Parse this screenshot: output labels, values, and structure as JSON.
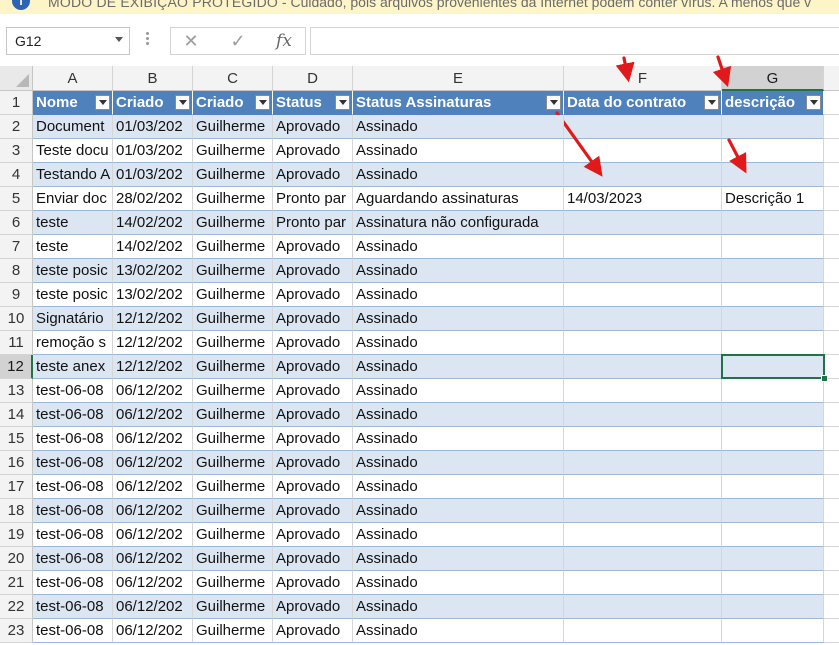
{
  "banner": {
    "title": "MODO DE EXIBIÇÃO PROTEGIDO",
    "message": "Cuidado, pois arquivos provenientes da Internet podem conter vírus. A menos que v"
  },
  "formula_bar": {
    "name_box": "G12",
    "cancel_icon": "✕",
    "enter_icon": "✓",
    "fx_label": "fx",
    "value": ""
  },
  "columns": [
    "A",
    "B",
    "C",
    "D",
    "E",
    "F",
    "G"
  ],
  "selected_cell": "G12",
  "headers": [
    "Nome",
    "Criado",
    "Criado",
    "Status",
    "Status Assinaturas",
    "Data do contrato",
    "descrição"
  ],
  "rows": [
    [
      "2",
      "Document",
      "01/03/202",
      "Guilherme",
      "Aprovado",
      "Assinado",
      "",
      ""
    ],
    [
      "3",
      "Teste docu",
      "01/03/202",
      "Guilherme",
      "Aprovado",
      "Assinado",
      "",
      ""
    ],
    [
      "4",
      "Testando A",
      "01/03/202",
      "Guilherme",
      "Aprovado",
      "Assinado",
      "",
      ""
    ],
    [
      "5",
      "Enviar doc",
      "28/02/202",
      "Guilherme",
      "Pronto par",
      "Aguardando assinaturas",
      "14/03/2023",
      "Descrição 1"
    ],
    [
      "6",
      "teste",
      "14/02/202",
      "Guilherme",
      "Pronto par",
      "Assinatura não configurada",
      "",
      ""
    ],
    [
      "7",
      "teste",
      "14/02/202",
      "Guilherme",
      "Aprovado",
      "Assinado",
      "",
      ""
    ],
    [
      "8",
      "teste posic",
      "13/02/202",
      "Guilherme",
      "Aprovado",
      "Assinado",
      "",
      ""
    ],
    [
      "9",
      "teste posic",
      "13/02/202",
      "Guilherme",
      "Aprovado",
      "Assinado",
      "",
      ""
    ],
    [
      "10",
      "Signatário",
      "12/12/202",
      "Guilherme",
      "Aprovado",
      "Assinado",
      "",
      ""
    ],
    [
      "11",
      "remoção s",
      "12/12/202",
      "Guilherme",
      "Aprovado",
      "Assinado",
      "",
      ""
    ],
    [
      "12",
      "teste anex",
      "12/12/202",
      "Guilherme",
      "Aprovado",
      "Assinado",
      "",
      ""
    ],
    [
      "13",
      "test-06-08",
      "06/12/202",
      "Guilherme",
      "Aprovado",
      "Assinado",
      "",
      ""
    ],
    [
      "14",
      "test-06-08",
      "06/12/202",
      "Guilherme",
      "Aprovado",
      "Assinado",
      "",
      ""
    ],
    [
      "15",
      "test-06-08",
      "06/12/202",
      "Guilherme",
      "Aprovado",
      "Assinado",
      "",
      ""
    ],
    [
      "16",
      "test-06-08",
      "06/12/202",
      "Guilherme",
      "Aprovado",
      "Assinado",
      "",
      ""
    ],
    [
      "17",
      "test-06-08",
      "06/12/202",
      "Guilherme",
      "Aprovado",
      "Assinado",
      "",
      ""
    ],
    [
      "18",
      "test-06-08",
      "06/12/202",
      "Guilherme",
      "Aprovado",
      "Assinado",
      "",
      ""
    ],
    [
      "19",
      "test-06-08",
      "06/12/202",
      "Guilherme",
      "Aprovado",
      "Assinado",
      "",
      ""
    ],
    [
      "20",
      "test-06-08",
      "06/12/202",
      "Guilherme",
      "Aprovado",
      "Assinado",
      "",
      ""
    ],
    [
      "21",
      "test-06-08",
      "06/12/202",
      "Guilherme",
      "Aprovado",
      "Assinado",
      "",
      ""
    ],
    [
      "22",
      "test-06-08",
      "06/12/202",
      "Guilherme",
      "Aprovado",
      "Assinado",
      "",
      ""
    ],
    [
      "23",
      "test-06-08",
      "06/12/202",
      "Guilherme",
      "Aprovado",
      "Assinado",
      "",
      ""
    ]
  ],
  "colors": {
    "header_fill": "#4f81bd",
    "band_fill": "#dce6f2",
    "selection": "#217346",
    "annotation_arrow": "#e01a1a",
    "banner_fill": "#fdf5c7"
  }
}
